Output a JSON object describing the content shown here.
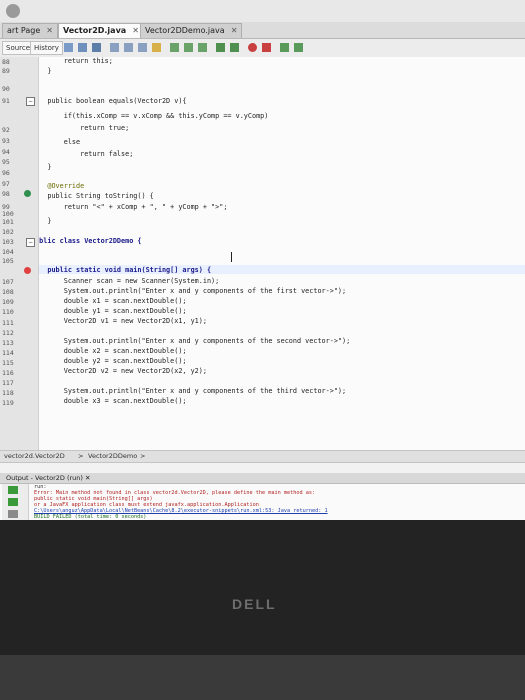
{
  "window": {
    "tabs": [
      {
        "label": "art Page"
      },
      {
        "label": "Vector2D.java"
      },
      {
        "label": "Vector2DDemo.java"
      }
    ]
  },
  "toolbar": {
    "source_label": "Source",
    "history_label": "History"
  },
  "code_lines": [
    {
      "num": "88",
      "text": "        return this;"
    },
    {
      "num": "89",
      "text": "    }"
    },
    {
      "num": "90",
      "text": ""
    },
    {
      "num": "91",
      "text": "    public boolean equals(Vector2D v){"
    },
    {
      "num": "92",
      "text": "        if(this.xComp == v.xComp && this.yComp == v.yComp)"
    },
    {
      "num": "93",
      "text": "            return true;"
    },
    {
      "num": "94",
      "text": "        else"
    },
    {
      "num": "95",
      "text": "            return false;"
    },
    {
      "num": "96",
      "text": "    }"
    },
    {
      "num": "97",
      "text": ""
    },
    {
      "num": "98",
      "text": "    @Override"
    },
    {
      "num": "99",
      "text": "    public String toString() {"
    },
    {
      "num": "100",
      "text": "        return \"<\" + xComp + \", \" + yComp + \">\";"
    },
    {
      "num": "101",
      "text": "    }"
    },
    {
      "num": "102",
      "text": ""
    },
    {
      "num": "103",
      "text": "public class Vector2DDemo {"
    },
    {
      "num": "104",
      "text": ""
    },
    {
      "num": "105",
      "text": ""
    },
    {
      "num": "106",
      "text": "    public static void main(String[] args) {"
    },
    {
      "num": "107",
      "text": "        Scanner scan = new Scanner(System.in);"
    },
    {
      "num": "108",
      "text": "        System.out.println(\"Enter x and y components of the first vector->\");"
    },
    {
      "num": "109",
      "text": "        double x1 = scan.nextDouble();"
    },
    {
      "num": "110",
      "text": "        double y1 = scan.nextDouble();"
    },
    {
      "num": "111",
      "text": "        Vector2D v1 = new Vector2D(x1, y1);"
    },
    {
      "num": "112",
      "text": ""
    },
    {
      "num": "113",
      "text": "        System.out.println(\"Enter x and y components of the second vector->\");"
    },
    {
      "num": "114",
      "text": "        double x2 = scan.nextDouble();"
    },
    {
      "num": "115",
      "text": "        double y2 = scan.nextDouble();"
    },
    {
      "num": "116",
      "text": "        Vector2D v2 = new Vector2D(x2, y2);"
    },
    {
      "num": "117",
      "text": ""
    },
    {
      "num": "118",
      "text": "        System.out.println(\"Enter x and y components of the third vector->\");"
    },
    {
      "num": "119",
      "text": "        double x3 = scan.nextDouble();"
    }
  ],
  "breadcrumbs": [
    "vector2d.Vector2D",
    "Vector2DDemo"
  ],
  "output": {
    "tab_label": "Output - Vector2D (run)",
    "lines": [
      "run:",
      "Error: Main method not found in class vector2d.Vector2D, please define the main method as:",
      "   public static void main(String[] args)",
      "or a JavaFX application class must extend javafx.application.Application",
      "C:\\Users\\anguz\\AppData\\Local\\NetBeans\\Cache\\8.2\\executor-snippets\\run.xml:53: Java returned: 1",
      "BUILD FAILED (total time: 0 seconds)"
    ]
  },
  "monitor": {
    "brand": "DELL"
  }
}
